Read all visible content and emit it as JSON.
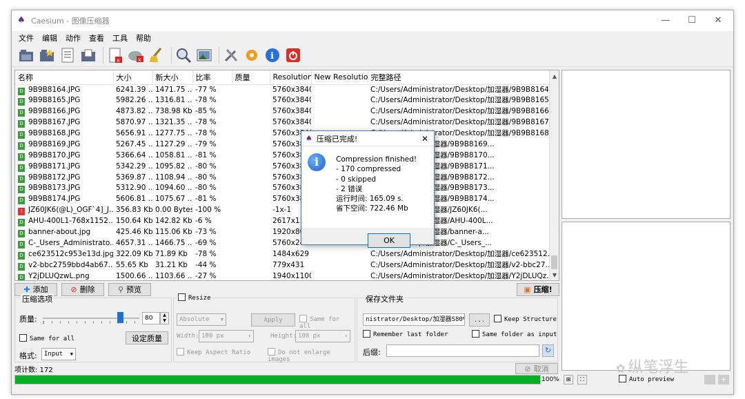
{
  "window": {
    "title": "Caesium - 图像压缩器",
    "minimize": "—",
    "maximize": "☐",
    "close": "✕"
  },
  "menu": [
    "文件",
    "编辑",
    "动作",
    "查看",
    "工具",
    "帮助"
  ],
  "toolbar_icons": [
    "open-files-icon",
    "open-folder-icon",
    "save-list-icon",
    "export-icon",
    "clear-list-icon",
    "remove-item-icon",
    "clean-icon",
    "search-icon",
    "preview-image-icon",
    "tools-icon",
    "settings-icon",
    "info-icon",
    "exit-icon"
  ],
  "table": {
    "headers": [
      "名称",
      "大小",
      "新大小",
      "比率",
      "质量",
      "Resolution",
      "New Resolution",
      "完整路径"
    ],
    "rows": [
      {
        "name": "9B9B8164.JPG",
        "size": "6241.39 ...",
        "newsize": "1471.75 ...",
        "ratio": "-77 %",
        "quality": "",
        "res": "5760x3840",
        "newres": "",
        "path": "C:/Users/Administrator/Desktop/加湿器/9B9B8164...",
        "error": false
      },
      {
        "name": "9B9B8165.JPG",
        "size": "5982.26 ...",
        "newsize": "1316.81 ...",
        "ratio": "-78 %",
        "quality": "",
        "res": "5760x3840",
        "newres": "",
        "path": "C:/Users/Administrator/Desktop/加湿器/9B9B8165...",
        "error": false
      },
      {
        "name": "9B9B8166.JPG",
        "size": "4873.82 ...",
        "newsize": "738.98 Kb",
        "ratio": "-85 %",
        "quality": "",
        "res": "5760x3840",
        "newres": "",
        "path": "C:/Users/Administrator/Desktop/加湿器/9B9B8166...",
        "error": false
      },
      {
        "name": "9B9B8167.JPG",
        "size": "5870.97 ...",
        "newsize": "1321.35 ...",
        "ratio": "-78 %",
        "quality": "",
        "res": "5760x3840",
        "newres": "",
        "path": "C:/Users/Administrator/Desktop/加湿器/9B9B8167...",
        "error": false
      },
      {
        "name": "9B9B8168.JPG",
        "size": "5656.91 ...",
        "newsize": "1277.75 ...",
        "ratio": "-78 %",
        "quality": "",
        "res": "5760x3840",
        "newres": "",
        "path": "C:/Users/Administrator/Desktop/加湿器/9B9B8168...",
        "error": false
      },
      {
        "name": "9B9B8169.JPG",
        "size": "5267.45 ...",
        "newsize": "1127.29 ...",
        "ratio": "-79 %",
        "quality": "",
        "res": "5760x3840",
        "newres": "",
        "path": "trator/Desktop/加湿器/9B9B8169...",
        "error": false
      },
      {
        "name": "9B9B8170.JPG",
        "size": "5366.64 ...",
        "newsize": "1058.81 ...",
        "ratio": "-81 %",
        "quality": "",
        "res": "5760x3840",
        "newres": "",
        "path": "trator/Desktop/加湿器/9B9B8170...",
        "error": false
      },
      {
        "name": "9B9B8171.JPG",
        "size": "5342.29 ...",
        "newsize": "1095.82 ...",
        "ratio": "-80 %",
        "quality": "",
        "res": "5760x3840",
        "newres": "",
        "path": "trator/Desktop/加湿器/9B9B8171...",
        "error": false
      },
      {
        "name": "9B9B8172.JPG",
        "size": "5369.87 ...",
        "newsize": "1108.94 ...",
        "ratio": "-80 %",
        "quality": "",
        "res": "5760x3840",
        "newres": "",
        "path": "trator/Desktop/加湿器/9B9B8172...",
        "error": false
      },
      {
        "name": "9B9B8173.JPG",
        "size": "5312.90 ...",
        "newsize": "1094.60 ...",
        "ratio": "-80 %",
        "quality": "",
        "res": "5760x3840",
        "newres": "",
        "path": "trator/Desktop/加湿器/9B9B8173...",
        "error": false
      },
      {
        "name": "9B9B8174.JPG",
        "size": "5606.81 ...",
        "newsize": "1075.67 ...",
        "ratio": "-81 %",
        "quality": "",
        "res": "5760x3840",
        "newres": "",
        "path": "trator/Desktop/加湿器/9B9B8174...",
        "error": false
      },
      {
        "name": "JZ60JK6(@L)_OGF`4]_J...",
        "size": "356.83 Kb",
        "newsize": "0.00 Bytes",
        "ratio": "-100 %",
        "quality": "",
        "res": "-1x-1",
        "newres": "",
        "path": "trator/Desktop/加湿器/JZ60JK6(...",
        "error": true
      },
      {
        "name": "AHU-400L1-768x1152...",
        "size": "150.64 Kb",
        "newsize": "142.82 Kb",
        "ratio": "-6 %",
        "quality": "",
        "res": "2617x1107",
        "newres": "",
        "path": "trator/Desktop/加湿器/AHU-400L...",
        "error": false
      },
      {
        "name": "banner-about.jpg",
        "size": "425.46 Kb",
        "newsize": "115.06 Kb",
        "ratio": "-73 %",
        "quality": "",
        "res": "1920x800",
        "newres": "",
        "path": "trator/Desktop/加湿器/banner-a...",
        "error": false
      },
      {
        "name": "C-_Users_Administrato...",
        "size": "4657.31 ...",
        "newsize": "1466.75 ...",
        "ratio": "-69 %",
        "quality": "",
        "res": "5760x2438",
        "newres": "",
        "path": "trator/Desktop/加湿器/C-_Users_...",
        "error": false
      },
      {
        "name": "ce623512c953e13d.jpg",
        "size": "322.09 Kb",
        "newsize": "71.89 Kb",
        "ratio": "-78 %",
        "quality": "",
        "res": "1484x629",
        "newres": "",
        "path": "C:/Users/Administrator/Desktop/加湿器/ce623512...",
        "error": false
      },
      {
        "name": "v2-bbc2759bbd4ab67...",
        "size": "55.65 Kb",
        "newsize": "31.21 Kb",
        "ratio": "-44 %",
        "quality": "",
        "res": "779x431",
        "newres": "",
        "path": "C:/Users/Administrator/Desktop/加湿器/v2-bbc27...",
        "error": false
      },
      {
        "name": "Y2jDLUQzwL.png",
        "size": "1500.66 ...",
        "newsize": "1103.66 ...",
        "ratio": "-27 %",
        "quality": "",
        "res": "1940x1100",
        "newres": "",
        "path": "C:/Users/Administrator/Desktop/加湿器/Y2jDLUQz...",
        "error": false
      }
    ]
  },
  "buttons": {
    "add": "添加",
    "remove": "删除",
    "preview": "预览",
    "compress": "压缩!"
  },
  "compression": {
    "group_label": "压缩选项",
    "quality_label": "质量:",
    "quality_value": "80",
    "same_for_all": "Same for all",
    "set_quality": "设定质量",
    "format_label": "格式:",
    "format_value": "Input"
  },
  "resize": {
    "label": "Resize",
    "mode": "Absolute",
    "apply": "Apply",
    "same_for_all": "Same for all",
    "width_label": "Width:",
    "width_value": "100 px",
    "height_label": "Height:",
    "height_value": "100 px",
    "keep_aspect": "Keep Aspect Ratio",
    "no_enlarge": "Do not enlarge images"
  },
  "output": {
    "group_label": "保存文件夹",
    "folder_value": "nistrator/Desktop/加湿器S80%",
    "browse": "...",
    "keep_structure": "Keep Structure",
    "remember_last": "Remember last folder",
    "same_folder": "Same folder as input",
    "suffix_label": "后缀:",
    "suffix_value": ""
  },
  "status": {
    "item_count": "项计数: 172",
    "cancel": "取消",
    "progress_fraction": 1.0,
    "progress_text": "100%",
    "auto_preview": "Auto preview"
  },
  "dialog": {
    "title": "压缩已完成!",
    "close": "✕",
    "message": "Compression finished!\n- 170 compressed\n- 0 skipped\n- 2 错误\n运行时间: 165.09 s.\n省下空间: 722.46 Mb",
    "ok": "OK"
  },
  "watermark": "纵笔浮生"
}
